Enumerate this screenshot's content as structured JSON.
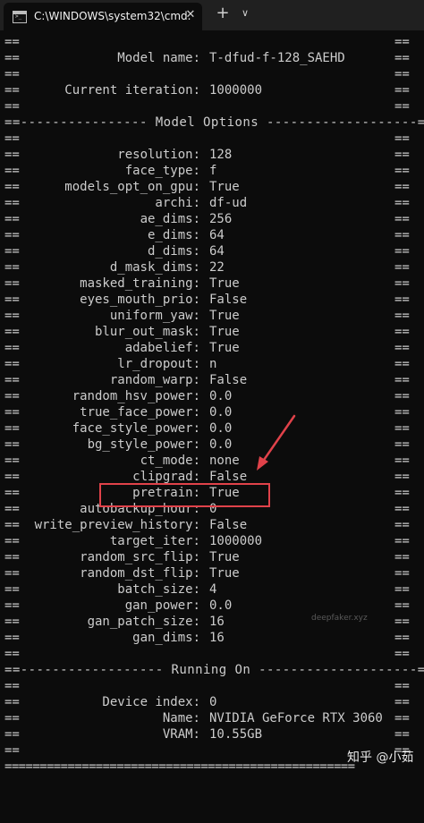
{
  "window": {
    "tab_title": "C:\\WINDOWS\\system32\\cmd.",
    "close_glyph": "✕",
    "new_tab_glyph": "+",
    "dropdown_glyph": "∨"
  },
  "console": {
    "border": "==",
    "rule_eq": "==================================================",
    "model_name": {
      "key": "Model name:",
      "value": "T-dfud-f-128_SAEHD"
    },
    "current_iteration": {
      "key": "Current iteration:",
      "value": "1000000"
    },
    "model_options_header": "==---------------- Model Options -------------------==",
    "options": [
      {
        "key": "resolution:",
        "value": "128"
      },
      {
        "key": "face_type:",
        "value": "f"
      },
      {
        "key": "models_opt_on_gpu:",
        "value": "True"
      },
      {
        "key": "archi:",
        "value": "df-ud"
      },
      {
        "key": "ae_dims:",
        "value": "256"
      },
      {
        "key": "e_dims:",
        "value": "64"
      },
      {
        "key": "d_dims:",
        "value": "64"
      },
      {
        "key": "d_mask_dims:",
        "value": "22"
      },
      {
        "key": "masked_training:",
        "value": "True"
      },
      {
        "key": "eyes_mouth_prio:",
        "value": "False"
      },
      {
        "key": "uniform_yaw:",
        "value": "True"
      },
      {
        "key": "blur_out_mask:",
        "value": "True"
      },
      {
        "key": "adabelief:",
        "value": "True"
      },
      {
        "key": "lr_dropout:",
        "value": "n"
      },
      {
        "key": "random_warp:",
        "value": "False"
      },
      {
        "key": "random_hsv_power:",
        "value": "0.0"
      },
      {
        "key": "true_face_power:",
        "value": "0.0"
      },
      {
        "key": "face_style_power:",
        "value": "0.0"
      },
      {
        "key": "bg_style_power:",
        "value": "0.0"
      },
      {
        "key": "ct_mode:",
        "value": "none"
      },
      {
        "key": "clipgrad:",
        "value": "False"
      },
      {
        "key": "pretrain:",
        "value": "True"
      },
      {
        "key": "autobackup_hour:",
        "value": "0"
      },
      {
        "key": "write_preview_history:",
        "value": "False"
      },
      {
        "key": "target_iter:",
        "value": "1000000"
      },
      {
        "key": "random_src_flip:",
        "value": "True"
      },
      {
        "key": "random_dst_flip:",
        "value": "True"
      },
      {
        "key": "batch_size:",
        "value": "4"
      },
      {
        "key": "gan_power:",
        "value": "0.0"
      },
      {
        "key": "gan_patch_size:",
        "value": "16"
      },
      {
        "key": "gan_dims:",
        "value": "16"
      }
    ],
    "running_on_header": "==------------------ Running On --------------------==",
    "device_index": {
      "key": "Device index:",
      "value": "0"
    },
    "device_name": {
      "key": "Name:",
      "value": "NVIDIA GeForce RTX 3060"
    },
    "vram": {
      "key": "VRAM:",
      "value": "10.55GB"
    }
  },
  "annotations": {
    "watermark": "deepfaker.xyz",
    "brand": "知乎 @小茹",
    "highlight_color": "#e0424a"
  }
}
